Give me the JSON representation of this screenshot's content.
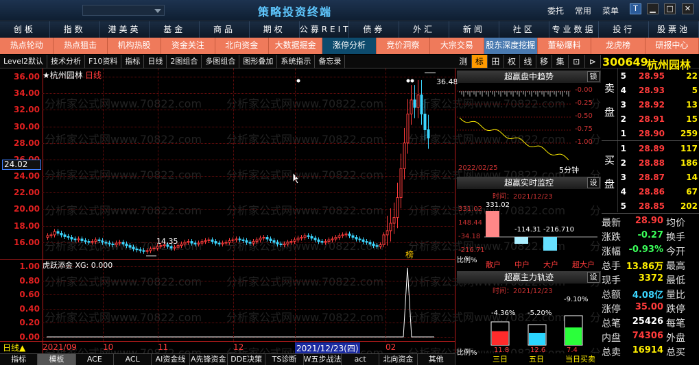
{
  "title_bar": {
    "app_title": "策略投资终端",
    "menus": [
      "委托",
      "常用",
      "菜单"
    ]
  },
  "nav1": [
    "创板",
    "指数",
    "港美英",
    "基金",
    "商品",
    "期权",
    "公募REITs",
    "债券",
    "外汇",
    "新闻",
    "社区",
    "专业数据",
    "投行",
    "股票池"
  ],
  "nav2": [
    "热点轮动",
    "热点狙击",
    "机构热股",
    "资金关注",
    "北向资金",
    "大数据掘金",
    "涨停分析",
    "竞价洞察",
    "大宗交易",
    "股东深度挖掘",
    "董秘爆料",
    "龙虎榜",
    "研报中心"
  ],
  "toolbar": [
    "Level2默认",
    "技术分析",
    "F10资料",
    "指标",
    "日线",
    "2图组合",
    "多图组合",
    "图形叠加",
    "系统指示",
    "备忘录"
  ],
  "toolbar_right": [
    "测",
    "标",
    "田",
    "权",
    "线",
    "移",
    "集",
    "⊡",
    "⊳"
  ],
  "chart": {
    "stock_label": "★杭州园林",
    "period": "日线",
    "current_price": "24.02",
    "high_label": "36.48",
    "low_label": "14.35",
    "lhb_label": "榜",
    "indicator_title": "虎跃添金 XG: 0.000",
    "price_axis": [
      "36.00",
      "34.00",
      "32.00",
      "30.00",
      "28.00",
      "26.00",
      "24.00",
      "22.00",
      "20.00",
      "18.00",
      "16.00"
    ],
    "ind_axis": [
      "1.00",
      "0.80",
      "0.60",
      "0.40",
      "0.20",
      "0.00"
    ],
    "date_labels": [
      "2021/09",
      "10",
      "11",
      "12",
      "2021/12/23(四)",
      "02"
    ],
    "period_switch": "日线▲",
    "watermark": "分析家公式网www.70822.com",
    "chart_data": {
      "type": "candlestick",
      "ylim": [
        14,
        37
      ],
      "close": [
        16.8,
        16.9,
        17.3,
        17.1,
        16.9,
        16.7,
        16.6,
        16.4,
        16.3,
        16.4,
        16.2,
        16.1,
        16.0,
        16.1,
        16.3,
        16.2,
        16.0,
        15.9,
        15.8,
        15.7,
        15.9,
        16.0,
        15.8,
        15.6,
        15.4,
        15.2,
        15.1,
        15.0,
        14.9,
        15.0,
        15.2,
        15.3,
        15.5,
        15.6,
        15.7,
        15.5,
        15.3,
        15.4,
        15.6,
        15.8,
        16.0,
        16.1,
        15.9,
        15.8,
        15.9,
        16.1,
        16.2,
        16.3,
        16.1,
        15.9,
        15.8,
        15.9,
        16.0,
        16.2,
        16.3,
        16.4,
        16.3,
        16.2,
        16.0,
        15.9,
        16.1,
        16.3,
        16.5,
        16.6,
        16.4,
        16.2,
        16.0,
        15.8,
        15.7,
        15.8,
        16.0,
        16.1,
        16.3,
        16.5,
        16.6,
        16.8,
        16.7,
        16.5,
        16.3,
        16.1,
        16.0,
        16.1,
        16.3,
        16.4,
        16.6,
        16.8,
        16.9,
        17.0,
        16.8,
        16.6,
        16.4,
        16.3,
        16.1,
        16.0,
        15.8,
        15.6,
        15.5,
        15.7,
        16.9,
        17.4,
        18.3,
        19.0,
        21.4,
        24.9,
        28.0,
        31.5,
        33.2,
        32.3,
        33.8,
        31.5,
        29.6,
        28.6
      ]
    }
  },
  "panel_trend": {
    "title": "超赢盘中趋势",
    "lock": "锁",
    "axis_right": [
      "-0.00",
      "-0.25",
      "-0.50",
      "-0.75",
      "-1.00"
    ],
    "date": "2022/02/25",
    "interval": "5分钟"
  },
  "panel_monitor": {
    "title": "超赢实时监控",
    "set": "设",
    "time": "时间：2021/12/23",
    "axis": [
      "331.02",
      "148.44",
      "-34.18",
      "-216.71"
    ],
    "values_label": [
      "331.02",
      "-114.31",
      "-216.710"
    ],
    "ratio": "比例%",
    "categories": [
      "散户",
      "中户",
      "大户",
      "超大户"
    ]
  },
  "panel_track": {
    "title": "超赢主力轨迹",
    "set": "设",
    "time": "时间：2021/12/23",
    "pct": [
      "-4.36%",
      "-5.20%",
      "-9.10%"
    ],
    "vals": [
      "11.8",
      "12.6",
      "7.4"
    ],
    "ratio": "比例%",
    "periods": [
      "三日",
      "五日",
      "当日买卖"
    ]
  },
  "quote": {
    "code": "300649",
    "name": "杭州园林",
    "sell_label": "卖盘",
    "buy_label": "买盘",
    "asks": [
      [
        "5",
        "28.95",
        "22"
      ],
      [
        "4",
        "28.93",
        "5"
      ],
      [
        "3",
        "28.92",
        "13"
      ],
      [
        "2",
        "28.91",
        "15"
      ],
      [
        "1",
        "28.90",
        "259"
      ]
    ],
    "bids": [
      [
        "1",
        "28.89",
        "117"
      ],
      [
        "2",
        "28.88",
        "186"
      ],
      [
        "3",
        "28.87",
        "14"
      ],
      [
        "4",
        "28.86",
        "67"
      ],
      [
        "5",
        "28.85",
        "202"
      ]
    ],
    "stats": [
      [
        "最新",
        "28.90",
        "均价"
      ],
      [
        "涨跌",
        "-0.27",
        "换手"
      ],
      [
        "涨幅",
        "-0.93%",
        "今开"
      ],
      [
        "总手",
        "13.86万",
        "最高"
      ],
      [
        "现手",
        "3372",
        "最低"
      ],
      [
        "总额",
        "4.08亿",
        "量比"
      ],
      [
        "涨停",
        "35.00",
        "跌停"
      ],
      [
        "总笔",
        "25426",
        "每笔"
      ],
      [
        "内盘",
        "74306",
        "外盘"
      ],
      [
        "总卖",
        "16914",
        "总买"
      ]
    ]
  },
  "bottombar": [
    "指标",
    "模板",
    "ACE",
    "ACL",
    "AI资金线",
    "A先锋资金",
    "DDE决策",
    "TS诊断",
    "W五步战法",
    "act",
    "北向资金",
    "其他"
  ]
}
